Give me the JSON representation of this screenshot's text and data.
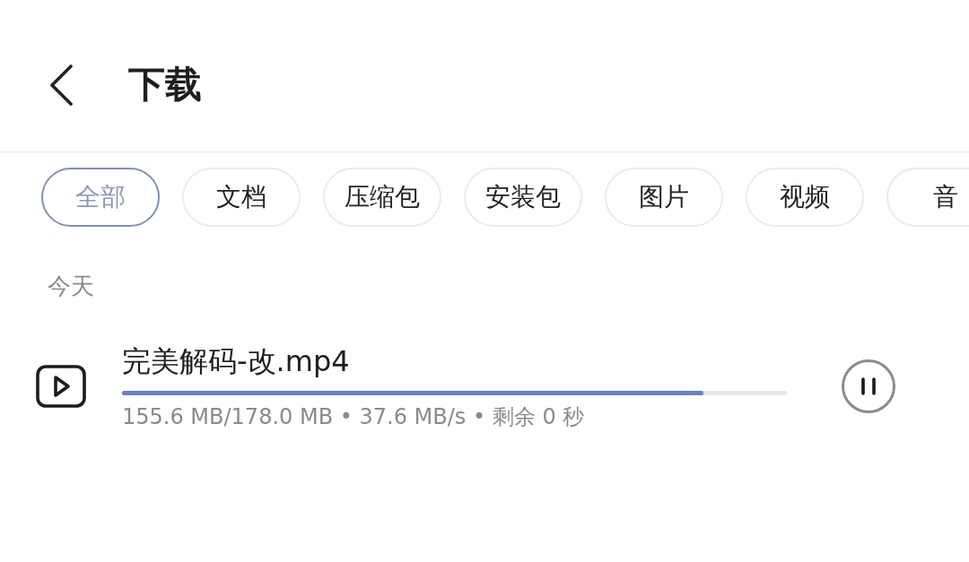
{
  "header": {
    "title": "下载"
  },
  "filter_chips": [
    {
      "label": "全部",
      "selected": true
    },
    {
      "label": "文档",
      "selected": false
    },
    {
      "label": "压缩包",
      "selected": false
    },
    {
      "label": "安装包",
      "selected": false
    },
    {
      "label": "图片",
      "selected": false
    },
    {
      "label": "视频",
      "selected": false
    },
    {
      "label": "音",
      "selected": false
    }
  ],
  "sections": [
    {
      "heading": "今天",
      "downloads": [
        {
          "file_name": "完美解码-改.mp4",
          "level": 0.874,
          "details": "155.6 MB/178.0 MB • 37.6 MB/s • 剩余 0 秒",
          "paused": false
        }
      ]
    }
  ]
}
